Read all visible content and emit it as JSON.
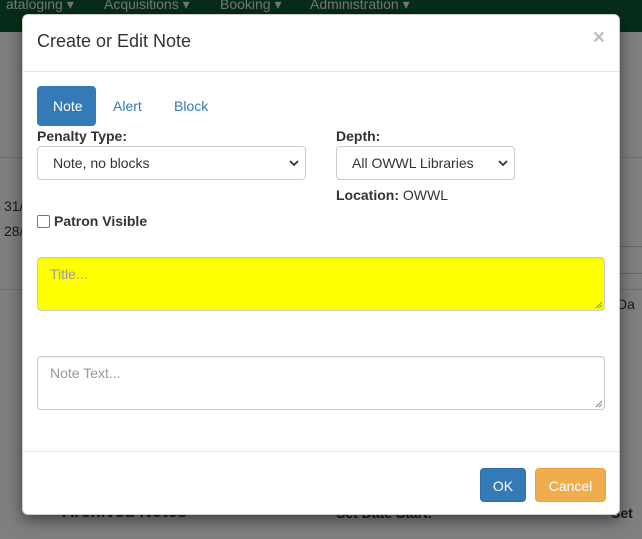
{
  "background": {
    "nav_items": [
      "ataloging ▾",
      "Acquisitions ▾",
      "Booking ▾",
      "Administration ▾"
    ],
    "archived_notes": "Archived Notes",
    "set_date_start": "Set Date Start:",
    "set_label": "Set",
    "left_frag_1": "31/",
    "left_frag_2": "28/",
    "right_frag": "Da"
  },
  "modal": {
    "title": "Create or Edit Note",
    "close_glyph": "×",
    "tabs": [
      {
        "label": "Note",
        "active": true
      },
      {
        "label": "Alert",
        "active": false
      },
      {
        "label": "Block",
        "active": false
      }
    ],
    "penalty_type": {
      "label": "Penalty Type:",
      "value": "Note, no blocks"
    },
    "depth": {
      "label": "Depth:",
      "value": "All OWWL Libraries"
    },
    "location": {
      "label": "Location:",
      "value": "OWWL"
    },
    "patron_visible": {
      "label": "Patron Visible",
      "checked": false
    },
    "title_field": {
      "placeholder": "Title...",
      "bg_color": "#ffff00"
    },
    "note_field": {
      "placeholder": "Note Text..."
    },
    "ok_label": "OK",
    "cancel_label": "Cancel"
  },
  "colors": {
    "primary": "#337ab7",
    "warning": "#f0ad4e",
    "nav": "#0e5a34"
  }
}
